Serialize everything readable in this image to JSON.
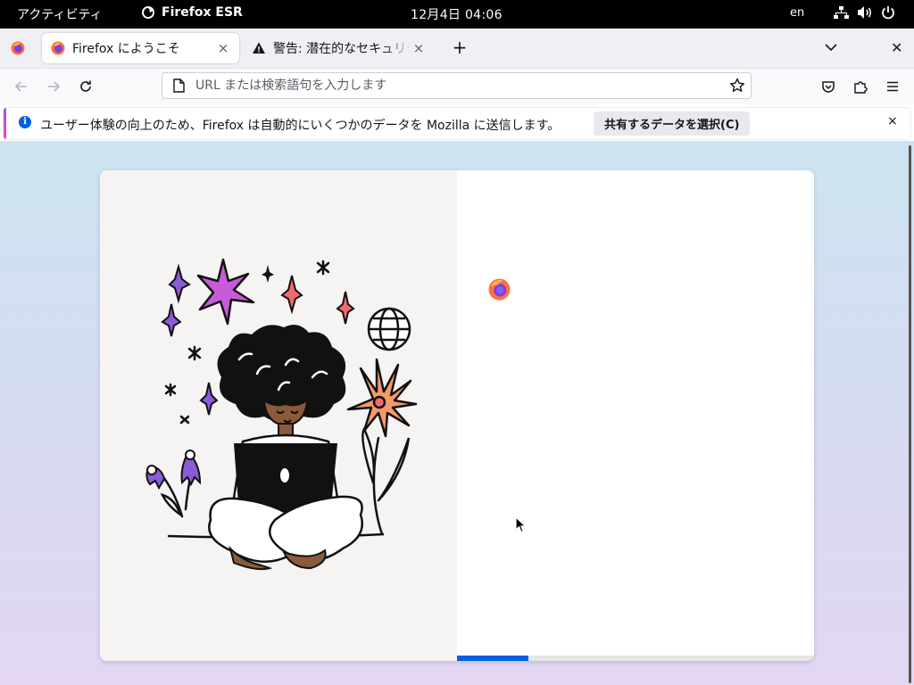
{
  "topbar": {
    "activities": "アクティビティ",
    "app_name": "Firefox ESR",
    "clock": "12月4日  04:06",
    "language": "en",
    "icons": [
      "network-icon",
      "volume-icon",
      "power-icon"
    ]
  },
  "tabs": [
    {
      "title": "Firefox にようこそ",
      "active": true,
      "icon": "firefox-icon",
      "close": "×"
    },
    {
      "title": "警告: 潜在的なセキュリティ",
      "active": false,
      "icon": "warning-icon",
      "close": "×"
    }
  ],
  "tabstrip": {
    "new_tab": "+",
    "window_close": "✕"
  },
  "navbar": {
    "url_placeholder": "URL または検索語句を入力します",
    "url_value": ""
  },
  "notification": {
    "message": "ユーザー体験の向上のため、Firefox は自動的にいくつかのデータを Mozilla に送信します。",
    "button": "共有するデータを選択(C)",
    "close": "×"
  },
  "onboarding": {
    "progress_fraction": 0.2
  },
  "colors": {
    "accent": "#0060df",
    "topbar": "#000000",
    "tabstrip": "#f0f0f4"
  }
}
